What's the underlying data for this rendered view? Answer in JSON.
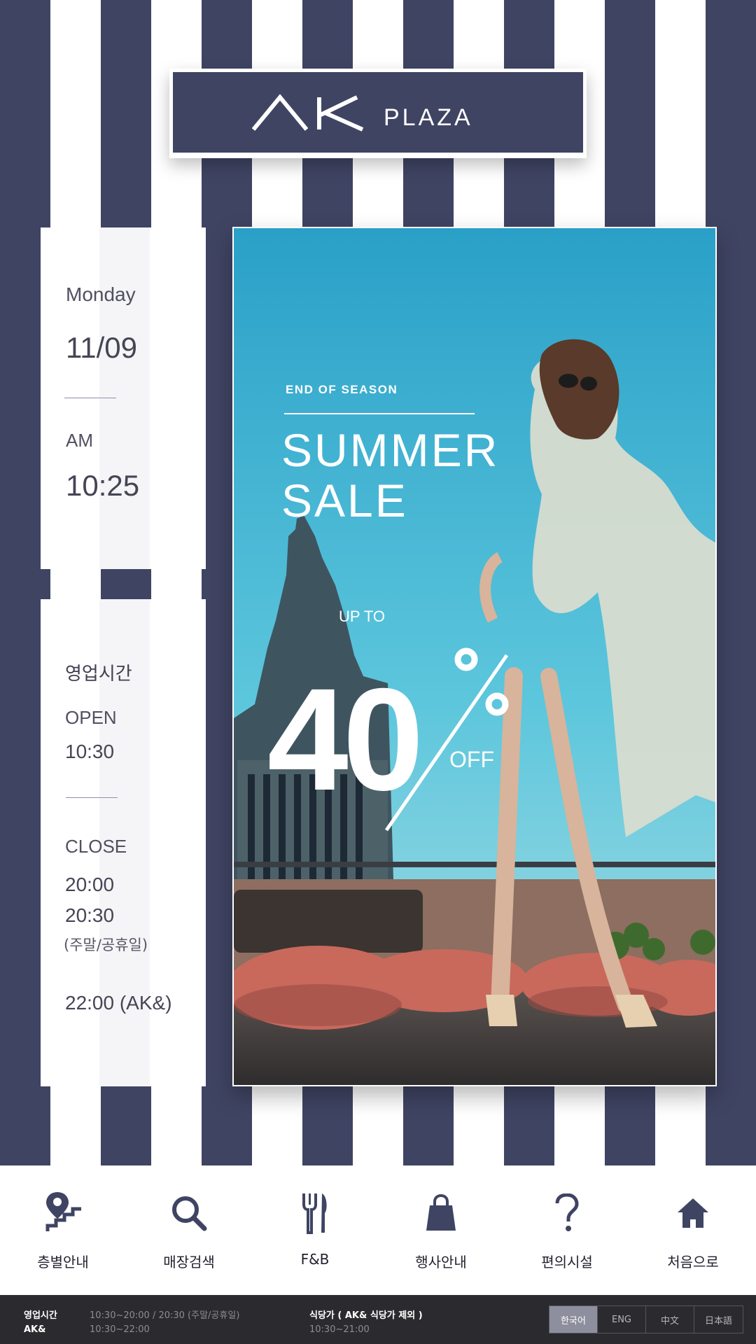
{
  "brand": {
    "logo_text": "AK PLAZA",
    "primary_color": "#3f4463"
  },
  "date_panel": {
    "day_name": "Monday",
    "date": "11/09",
    "ampm": "AM",
    "time": "10:25"
  },
  "hours_panel": {
    "title": "영업시간",
    "open_label": "OPEN",
    "open_time": "10:30",
    "close_label": "CLOSE",
    "close_time_weekday": "20:00",
    "close_time_weekend": "20:30",
    "close_weekend_note": "(주말/공휴일)",
    "close_time_ak": "22:00 (AK&)"
  },
  "promo": {
    "eyebrow": "END OF SEASON",
    "headline_1": "SUMMER",
    "headline_2": "SALE",
    "up_to": "UP TO",
    "discount_number": "40",
    "percent_sign": "%",
    "off": "OFF",
    "discount_percent": 40
  },
  "nav": {
    "items": [
      {
        "label": "층별안내",
        "icon": "floor-stairs-pin-icon"
      },
      {
        "label": "매장검색",
        "icon": "search-icon"
      },
      {
        "label": "F&B",
        "icon": "fork-knife-icon"
      },
      {
        "label": "행사안내",
        "icon": "shopping-bag-icon"
      },
      {
        "label": "편의시설",
        "icon": "question-icon"
      },
      {
        "label": "처음으로",
        "icon": "home-icon"
      }
    ]
  },
  "footer": {
    "hours_label": "영업시간",
    "hours_value": "10:30~20:00 / 20:30 (주말/공휴일)",
    "ak_label": "AK&",
    "ak_value": "10:30~22:00",
    "restaurant_label": "식당가 ( AK& 식당가 제외 )",
    "restaurant_value": "10:30~21:00",
    "languages": [
      "한국어",
      "ENG",
      "中文",
      "日本語"
    ],
    "selected_language": "한국어"
  }
}
